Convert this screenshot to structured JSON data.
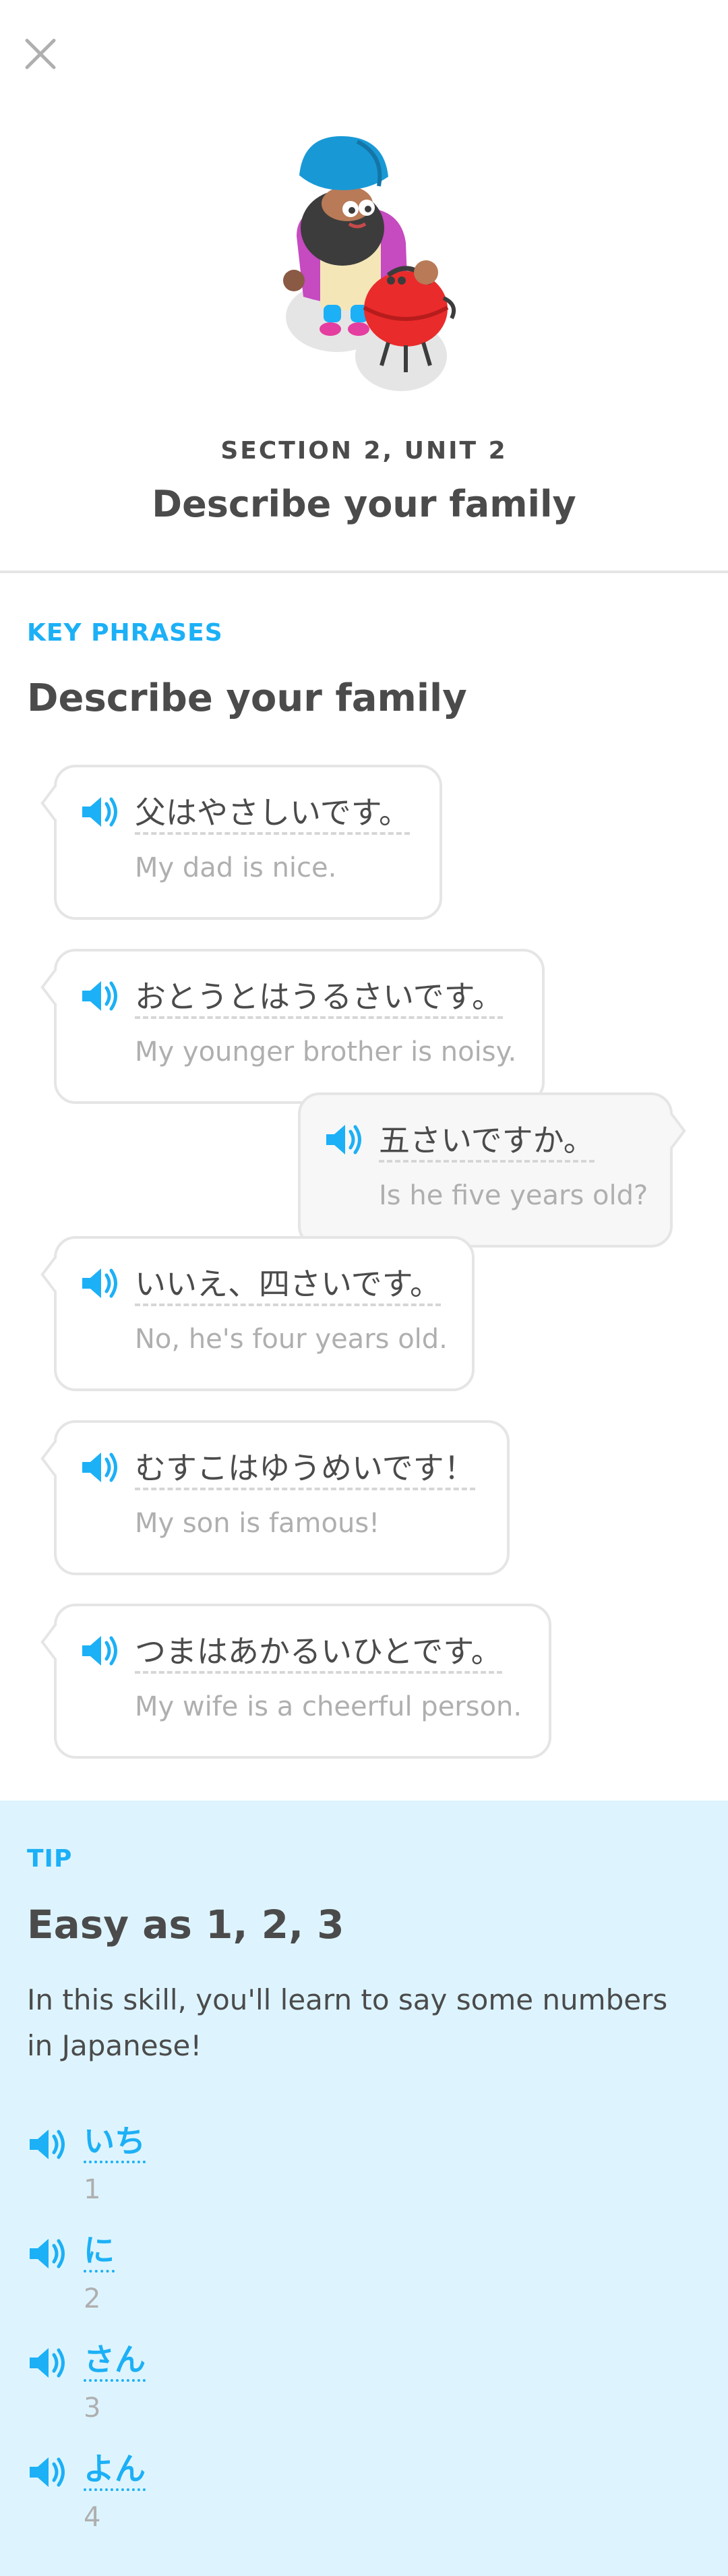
{
  "header": {
    "close_icon": "close-icon",
    "section_label": "SECTION 2, UNIT 2",
    "unit_title": "Describe your family"
  },
  "key_phrases": {
    "label": "KEY PHRASES",
    "title": "Describe your family",
    "phrases": [
      {
        "side": "left",
        "japanese": "父はやさしいです。",
        "english": "My dad is nice."
      },
      {
        "side": "left",
        "japanese": "おとうとはうるさいです。",
        "english": "My younger brother is noisy."
      },
      {
        "side": "right",
        "japanese": "五さいですか。",
        "english": "Is he five years old?"
      },
      {
        "side": "left",
        "japanese": "いいえ、四さいです。",
        "english": "No, he's four years old."
      },
      {
        "side": "left",
        "japanese": "むすこはゆうめいです！",
        "english": "My son is famous!"
      },
      {
        "side": "left",
        "japanese": "つまはあかるいひとです。",
        "english": "My wife is a cheerful person."
      }
    ]
  },
  "tip": {
    "label": "TIP",
    "title": "Easy as 1, 2, 3",
    "body": "In this skill, you'll learn to say some numbers in Japanese!",
    "numbers": [
      {
        "word": "いち",
        "value": "1"
      },
      {
        "word": "に",
        "value": "2"
      },
      {
        "word": "さん",
        "value": "3"
      },
      {
        "word": "よん",
        "value": "4"
      }
    ]
  },
  "colors": {
    "accent": "#1cb0f6",
    "tip_background": "#ddf4ff",
    "text": "#4b4b4b",
    "muted": "#afafaf",
    "border": "#e5e5e5"
  },
  "icons": {
    "speaker": "speaker-icon",
    "character": "character-illustration"
  }
}
